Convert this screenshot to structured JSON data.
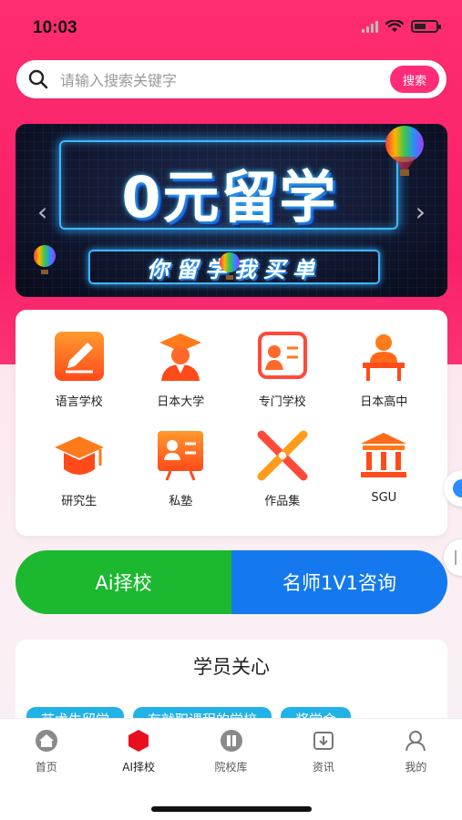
{
  "status": {
    "time": "10:03"
  },
  "search": {
    "placeholder": "请输入搜索关键字",
    "button": "搜索"
  },
  "banner": {
    "title": "0元留学",
    "subtitle": "你留学我买单"
  },
  "categories": [
    {
      "label": "语言学校",
      "icon": "pencil-icon"
    },
    {
      "label": "日本大学",
      "icon": "graduate-icon"
    },
    {
      "label": "专门学校",
      "icon": "certificate-icon"
    },
    {
      "label": "日本高中",
      "icon": "student-desk-icon"
    },
    {
      "label": "研究生",
      "icon": "mortarboard-icon"
    },
    {
      "label": "私塾",
      "icon": "teacher-board-icon"
    },
    {
      "label": "作品集",
      "icon": "portfolio-icon"
    },
    {
      "label": "SGU",
      "icon": "institution-icon"
    }
  ],
  "actions": {
    "left": "Ai择校",
    "right": "名师1V1咨询"
  },
  "care": {
    "title": "学员关心",
    "tags": [
      "艺术生留学",
      "有就职课程的学校",
      "奖学金"
    ]
  },
  "tabs": [
    {
      "label": "首页",
      "icon": "home-icon",
      "active": false
    },
    {
      "label": "AI择校",
      "icon": "ai-hexagon-icon",
      "active": true
    },
    {
      "label": "院校库",
      "icon": "school-library-icon",
      "active": false
    },
    {
      "label": "资讯",
      "icon": "news-icon",
      "active": false
    },
    {
      "label": "我的",
      "icon": "profile-icon",
      "active": false
    }
  ],
  "colors": {
    "brand": "#ff2d78",
    "green": "#1cb830",
    "blue": "#1479ef",
    "orange": "#ff7a1a",
    "tag": "#22b3e6"
  }
}
